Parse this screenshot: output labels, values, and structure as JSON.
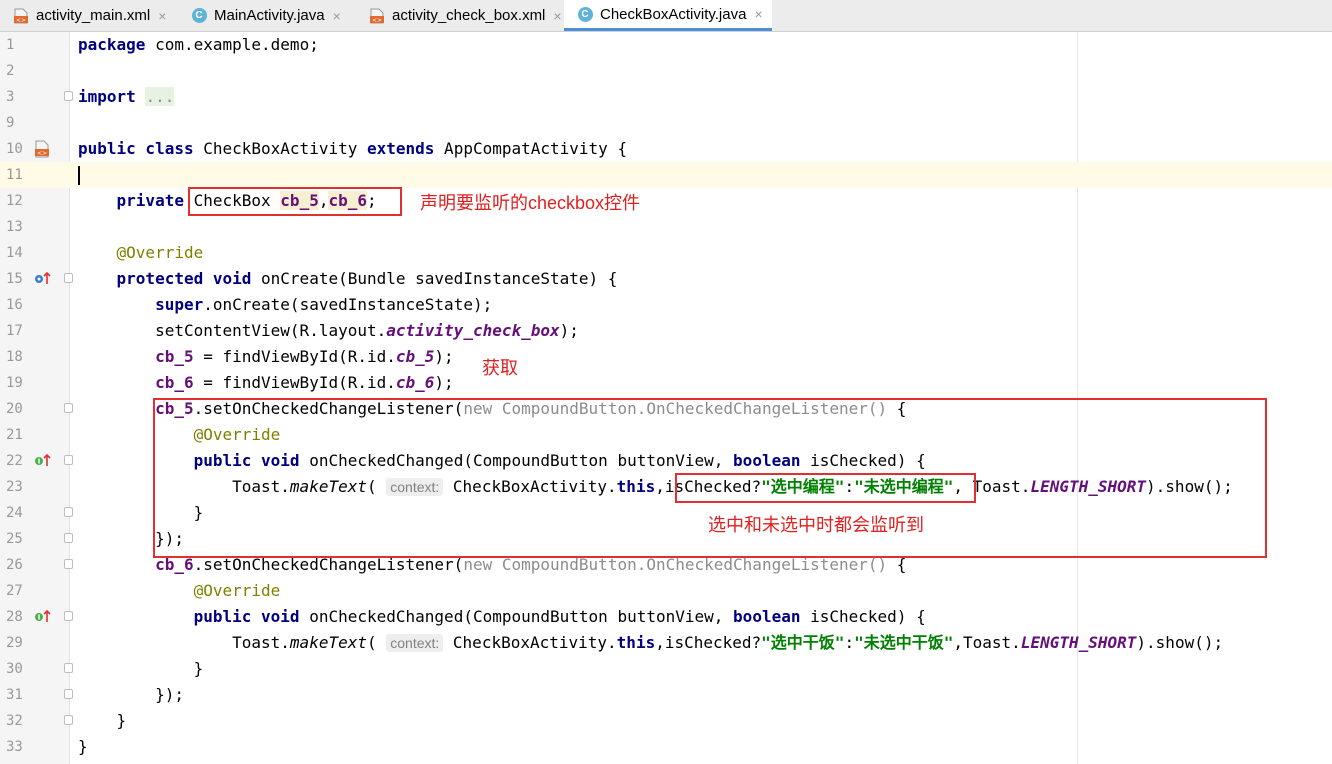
{
  "tabs": [
    {
      "label": "activity_main.xml",
      "icon": "xml-file-icon"
    },
    {
      "label": "MainActivity.java",
      "icon": "java-class-icon"
    },
    {
      "label": "activity_check_box.xml",
      "icon": "xml-file-icon"
    },
    {
      "label": "CheckBoxActivity.java",
      "icon": "java-class-icon",
      "active": true
    }
  ],
  "tab_close": "×",
  "line_numbers": [
    "1",
    "2",
    "3",
    "9",
    "10",
    "11",
    "12",
    "13",
    "14",
    "15",
    "16",
    "17",
    "18",
    "19",
    "20",
    "21",
    "22",
    "23",
    "24",
    "25",
    "26",
    "27",
    "28",
    "29",
    "30",
    "31",
    "32",
    "33"
  ],
  "code": {
    "l1": {
      "kw": "package",
      "rest": " com.example.demo;"
    },
    "l3": {
      "kw": "import",
      "dots": "..."
    },
    "l10": {
      "kw1": "public class",
      "name": " CheckBoxActivity ",
      "kw2": "extends",
      "rest": " AppCompatActivity {"
    },
    "l12": {
      "kw": "private",
      "type": " CheckBox ",
      "f1": "cb_5",
      "comma": ",",
      "f2": "cb_6",
      "semi": ";"
    },
    "l14": {
      "ann": "@Override"
    },
    "l15": {
      "kw": "protected void",
      "rest": " onCreate(Bundle savedInstanceState) {"
    },
    "l16": {
      "kw": "super",
      "rest": ".onCreate(savedInstanceState);"
    },
    "l17": {
      "a": "setContentView(R.layout.",
      "it": "activity_check_box",
      "b": ");"
    },
    "l18": {
      "f": "cb_5",
      "a": " = findViewById(R.id.",
      "it": "cb_5",
      "b": ");"
    },
    "l19": {
      "f": "cb_6",
      "a": " = findViewById(R.id.",
      "it": "cb_6",
      "b": ");"
    },
    "l20": {
      "f": "cb_5",
      "a": ".setOnCheckedChangeListener(",
      "kw": "new",
      "g": " CompoundButton.OnCheckedChangeListener()",
      "b": " {"
    },
    "l21": {
      "ann": "@Override"
    },
    "l22": {
      "kw": "public void",
      "a": " onCheckedChanged(CompoundButton buttonView, ",
      "kw2": "boolean",
      "b": " isChecked) {"
    },
    "l23": {
      "a": "Toast.",
      "it": "makeText",
      "b": "( ",
      "hint": "context:",
      "c": " CheckBoxActivity.",
      "kw": "this",
      "d": ",isChecked?",
      "s1": "\"选中编程\"",
      "e": ":",
      "s2": "\"未选中编程\"",
      "f": ", Toast.",
      "it2": "LENGTH_SHORT",
      "g": ").show();"
    },
    "l24": {
      "a": "}"
    },
    "l25": {
      "a": "});"
    },
    "l26": {
      "f": "cb_6",
      "a": ".setOnCheckedChangeListener(",
      "kw": "new",
      "g": " CompoundButton.OnCheckedChangeListener()",
      "b": " {"
    },
    "l27": {
      "ann": "@Override"
    },
    "l28": {
      "kw": "public void",
      "a": " onCheckedChanged(CompoundButton buttonView, ",
      "kw2": "boolean",
      "b": " isChecked) {"
    },
    "l29": {
      "a": "Toast.",
      "it": "makeText",
      "b": "( ",
      "hint": "context:",
      "c": " CheckBoxActivity.",
      "kw": "this",
      "d": ",isChecked?",
      "s1": "\"选中干饭\"",
      "e": ":",
      "s2": "\"未选中干饭\"",
      "f": ",Toast.",
      "it2": "LENGTH_SHORT",
      "g": ").show();"
    },
    "l30": {
      "a": "}"
    },
    "l31": {
      "a": "});"
    },
    "l32": {
      "a": "}"
    },
    "l33": {
      "a": "}"
    }
  },
  "annotations": {
    "declare_note": "声明要监听的checkbox控件",
    "get_note": "获取",
    "listen_note": "选中和未选中时都会监听到",
    "color": "#e02020"
  }
}
